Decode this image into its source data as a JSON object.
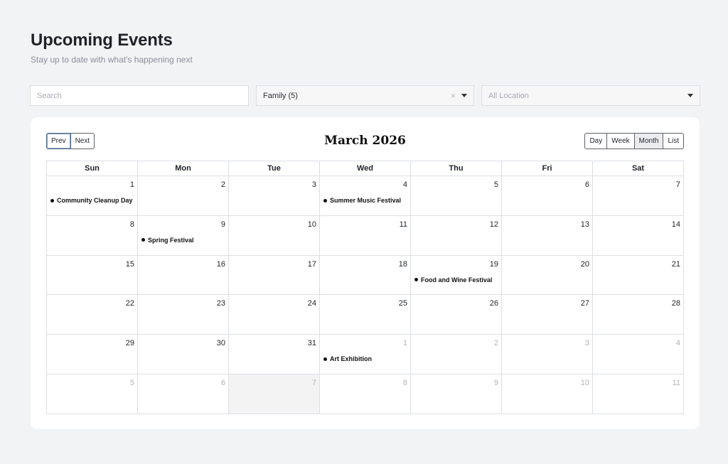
{
  "header": {
    "title": "Upcoming Events",
    "subtitle": "Stay up to date with what's happening next"
  },
  "filters": {
    "search_placeholder": "Search",
    "category_value": "Family (5)",
    "clear_symbol": "×",
    "location_value": "All Location"
  },
  "calendar": {
    "title": "March 2026",
    "nav": {
      "prev": "Prev",
      "next": "Next"
    },
    "views": [
      {
        "label": "Day",
        "active": false
      },
      {
        "label": "Week",
        "active": false
      },
      {
        "label": "Month",
        "active": true
      },
      {
        "label": "List",
        "active": false
      }
    ],
    "weekdays": [
      "Sun",
      "Mon",
      "Tue",
      "Wed",
      "Thu",
      "Fri",
      "Sat"
    ],
    "weeks": [
      [
        {
          "day": "1",
          "other": false,
          "event": "Community Cleanup Day"
        },
        {
          "day": "2",
          "other": false
        },
        {
          "day": "3",
          "other": false
        },
        {
          "day": "4",
          "other": false,
          "event": "Summer Music Festival"
        },
        {
          "day": "5",
          "other": false
        },
        {
          "day": "6",
          "other": false
        },
        {
          "day": "7",
          "other": false
        }
      ],
      [
        {
          "day": "8",
          "other": false
        },
        {
          "day": "9",
          "other": false,
          "event": "Spring Festival"
        },
        {
          "day": "10",
          "other": false
        },
        {
          "day": "11",
          "other": false
        },
        {
          "day": "12",
          "other": false
        },
        {
          "day": "13",
          "other": false
        },
        {
          "day": "14",
          "other": false
        }
      ],
      [
        {
          "day": "15",
          "other": false
        },
        {
          "day": "16",
          "other": false
        },
        {
          "day": "17",
          "other": false
        },
        {
          "day": "18",
          "other": false
        },
        {
          "day": "19",
          "other": false,
          "event": "Food and Wine Festival"
        },
        {
          "day": "20",
          "other": false
        },
        {
          "day": "21",
          "other": false
        }
      ],
      [
        {
          "day": "22",
          "other": false
        },
        {
          "day": "23",
          "other": false
        },
        {
          "day": "24",
          "other": false
        },
        {
          "day": "25",
          "other": false
        },
        {
          "day": "26",
          "other": false
        },
        {
          "day": "27",
          "other": false
        },
        {
          "day": "28",
          "other": false
        }
      ],
      [
        {
          "day": "29",
          "other": false
        },
        {
          "day": "30",
          "other": false
        },
        {
          "day": "31",
          "other": false
        },
        {
          "day": "1",
          "other": true,
          "event": "Art Exhibition"
        },
        {
          "day": "2",
          "other": true
        },
        {
          "day": "3",
          "other": true
        },
        {
          "day": "4",
          "other": true
        }
      ],
      [
        {
          "day": "5",
          "other": true
        },
        {
          "day": "6",
          "other": true
        },
        {
          "day": "7",
          "other": true,
          "today": true
        },
        {
          "day": "8",
          "other": true
        },
        {
          "day": "9",
          "other": true
        },
        {
          "day": "10",
          "other": true
        },
        {
          "day": "11",
          "other": true
        }
      ]
    ]
  },
  "colors": {
    "background": "#f2f3f5",
    "today_highlight": "#f3f3f4",
    "event_dot": "#111111"
  }
}
